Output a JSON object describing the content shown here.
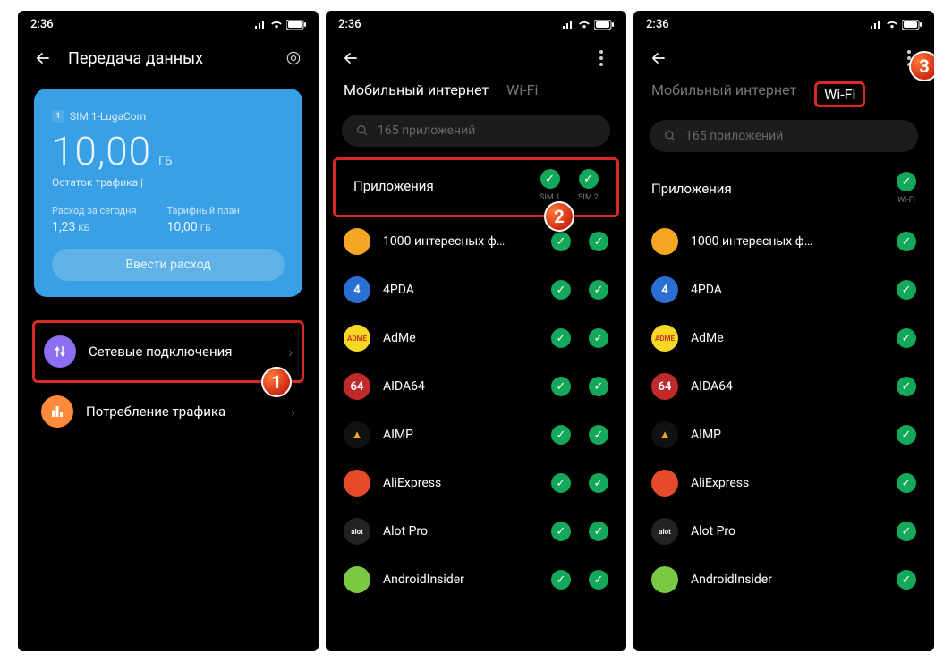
{
  "status_time": "2:36",
  "screen1": {
    "title": "Передача данных",
    "sim_label": "SIM 1-LugaCom",
    "data_value": "10,00",
    "data_unit": "ГБ",
    "data_sub": "Остаток трафика |",
    "stat1_label": "Расход за сегодня",
    "stat1_value": "1,23",
    "stat1_unit": "КБ",
    "stat2_label": "Тарифный план",
    "stat2_value": "10,00",
    "stat2_unit": "ГБ",
    "enter_btn": "Ввести расход",
    "menu1": "Сетевые подключения",
    "menu2": "Потребление трафика",
    "badge": "1"
  },
  "screen2": {
    "tab1": "Мобильный интернет",
    "tab2": "Wi-Fi",
    "search_placeholder": "165 приложений",
    "apps_label": "Приложения",
    "col1": "SIM 1",
    "col2": "SIM 2",
    "badge": "2",
    "apps": [
      {
        "name": "1000 интересных ф…",
        "bg": "#f5a623",
        "fg": "#fff",
        "txt": ""
      },
      {
        "name": "4PDA",
        "bg": "#2a6fd4",
        "fg": "#fff",
        "txt": "4"
      },
      {
        "name": "AdMe",
        "bg": "#f5d823",
        "fg": "#d0392a",
        "txt": "ADME"
      },
      {
        "name": "AIDA64",
        "bg": "#c02a2a",
        "fg": "#fff",
        "txt": "64"
      },
      {
        "name": "AIMP",
        "bg": "#111",
        "fg": "#f5a623",
        "txt": "▲"
      },
      {
        "name": "AliExpress",
        "bg": "#e64a2a",
        "fg": "#fff",
        "txt": ""
      },
      {
        "name": "Alot Pro",
        "bg": "#222",
        "fg": "#eee",
        "txt": "alot"
      },
      {
        "name": "AndroidInsider",
        "bg": "#7ac943",
        "fg": "#111",
        "txt": ""
      }
    ]
  },
  "screen3": {
    "tab1": "Мобильный интернет",
    "tab2": "Wi-Fi",
    "search_placeholder": "165 приложений",
    "apps_label": "Приложения",
    "col1": "Wi-Fi",
    "badge": "3",
    "apps": [
      {
        "name": "1000 интересных ф…",
        "bg": "#f5a623",
        "fg": "#fff",
        "txt": ""
      },
      {
        "name": "4PDA",
        "bg": "#2a6fd4",
        "fg": "#fff",
        "txt": "4"
      },
      {
        "name": "AdMe",
        "bg": "#f5d823",
        "fg": "#d0392a",
        "txt": "ADME"
      },
      {
        "name": "AIDA64",
        "bg": "#c02a2a",
        "fg": "#fff",
        "txt": "64"
      },
      {
        "name": "AIMP",
        "bg": "#111",
        "fg": "#f5a623",
        "txt": "▲"
      },
      {
        "name": "AliExpress",
        "bg": "#e64a2a",
        "fg": "#fff",
        "txt": ""
      },
      {
        "name": "Alot Pro",
        "bg": "#222",
        "fg": "#eee",
        "txt": "alot"
      },
      {
        "name": "AndroidInsider",
        "bg": "#7ac943",
        "fg": "#111",
        "txt": ""
      }
    ]
  }
}
